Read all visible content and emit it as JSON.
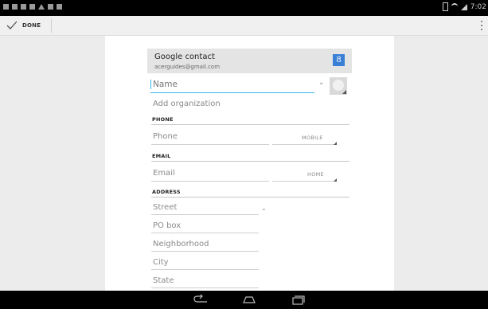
{
  "status_bar": {
    "time": "7:02"
  },
  "action_bar": {
    "done_label": "DONE"
  },
  "account": {
    "name": "Google contact",
    "email": "acerguides@gmail.com",
    "provider_icon_glyph": "8"
  },
  "form": {
    "name_placeholder": "Name",
    "add_organization": "Add organization",
    "phone": {
      "header": "PHONE",
      "placeholder": "Phone",
      "type": "MOBILE"
    },
    "email": {
      "header": "EMAIL",
      "placeholder": "Email",
      "type": "HOME"
    },
    "address": {
      "header": "ADDRESS",
      "fields": [
        "Street",
        "PO box",
        "Neighborhood",
        "City",
        "State"
      ]
    }
  },
  "icons": {
    "done": "checkmark-icon",
    "overflow": "overflow-menu-icon",
    "nav": [
      "back-icon",
      "home-icon",
      "recent-apps-icon"
    ]
  },
  "colors": {
    "accent": "#33b5e5",
    "google_badge": "#3a7fd5",
    "status_bar": "#000000",
    "nav_bar": "#000000"
  }
}
